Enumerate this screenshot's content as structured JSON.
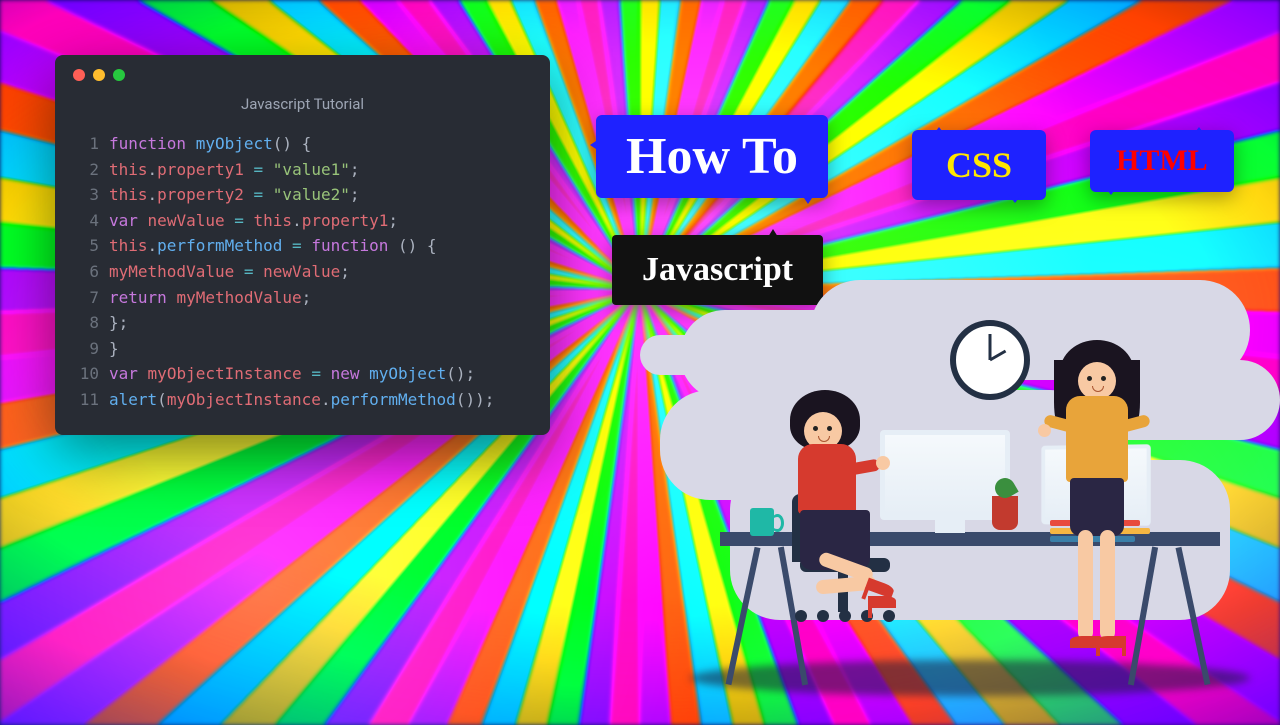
{
  "editor": {
    "title": "Javascript Tutorial",
    "lines": [
      {
        "ln": "1",
        "tokens": [
          {
            "c": "kw",
            "t": "function"
          },
          {
            "c": "plain",
            "t": " "
          },
          {
            "c": "fn",
            "t": "myObject"
          },
          {
            "c": "plain",
            "t": "() {"
          }
        ]
      },
      {
        "ln": "2",
        "tokens": [
          {
            "c": "plain",
            "t": "    "
          },
          {
            "c": "this",
            "t": "this"
          },
          {
            "c": "plain",
            "t": "."
          },
          {
            "c": "prop",
            "t": "property1"
          },
          {
            "c": "plain",
            "t": " "
          },
          {
            "c": "op",
            "t": "="
          },
          {
            "c": "plain",
            "t": " "
          },
          {
            "c": "str",
            "t": "\"value1\""
          },
          {
            "c": "plain",
            "t": ";"
          }
        ]
      },
      {
        "ln": "3",
        "tokens": [
          {
            "c": "plain",
            "t": "    "
          },
          {
            "c": "this",
            "t": "this"
          },
          {
            "c": "plain",
            "t": "."
          },
          {
            "c": "prop",
            "t": "property2"
          },
          {
            "c": "plain",
            "t": " "
          },
          {
            "c": "op",
            "t": "="
          },
          {
            "c": "plain",
            "t": " "
          },
          {
            "c": "str",
            "t": "\"value2\""
          },
          {
            "c": "plain",
            "t": ";"
          }
        ]
      },
      {
        "ln": "4",
        "tokens": [
          {
            "c": "plain",
            "t": "    "
          },
          {
            "c": "kw",
            "t": "var"
          },
          {
            "c": "plain",
            "t": " "
          },
          {
            "c": "var",
            "t": "newValue"
          },
          {
            "c": "plain",
            "t": " "
          },
          {
            "c": "op",
            "t": "="
          },
          {
            "c": "plain",
            "t": " "
          },
          {
            "c": "this",
            "t": "this"
          },
          {
            "c": "plain",
            "t": "."
          },
          {
            "c": "prop",
            "t": "property1"
          },
          {
            "c": "plain",
            "t": ";"
          }
        ]
      },
      {
        "ln": "5",
        "tokens": [
          {
            "c": "plain",
            "t": "    "
          },
          {
            "c": "this",
            "t": "this"
          },
          {
            "c": "plain",
            "t": "."
          },
          {
            "c": "meth",
            "t": "performMethod"
          },
          {
            "c": "plain",
            "t": " "
          },
          {
            "c": "op",
            "t": "="
          },
          {
            "c": "plain",
            "t": " "
          },
          {
            "c": "kw",
            "t": "function"
          },
          {
            "c": "plain",
            "t": " () {"
          }
        ]
      },
      {
        "ln": "6",
        "tokens": [
          {
            "c": "plain",
            "t": "        "
          },
          {
            "c": "var",
            "t": "myMethodValue"
          },
          {
            "c": "plain",
            "t": " "
          },
          {
            "c": "op",
            "t": "="
          },
          {
            "c": "plain",
            "t": " "
          },
          {
            "c": "var",
            "t": "newValue"
          },
          {
            "c": "plain",
            "t": ";"
          }
        ]
      },
      {
        "ln": "7",
        "tokens": [
          {
            "c": "plain",
            "t": "        "
          },
          {
            "c": "kw",
            "t": "return"
          },
          {
            "c": "plain",
            "t": " "
          },
          {
            "c": "var",
            "t": "myMethodValue"
          },
          {
            "c": "plain",
            "t": ";"
          }
        ]
      },
      {
        "ln": "8",
        "tokens": [
          {
            "c": "plain",
            "t": "    };"
          }
        ]
      },
      {
        "ln": "9",
        "tokens": [
          {
            "c": "plain",
            "t": "}"
          }
        ]
      },
      {
        "ln": "10",
        "tokens": [
          {
            "c": "kw",
            "t": "var"
          },
          {
            "c": "plain",
            "t": " "
          },
          {
            "c": "var",
            "t": "myObjectInstance"
          },
          {
            "c": "plain",
            "t": " "
          },
          {
            "c": "op",
            "t": "="
          },
          {
            "c": "plain",
            "t": " "
          },
          {
            "c": "new",
            "t": "new"
          },
          {
            "c": "plain",
            "t": " "
          },
          {
            "c": "fn",
            "t": "myObject"
          },
          {
            "c": "plain",
            "t": "();"
          }
        ]
      },
      {
        "ln": "11",
        "tokens": [
          {
            "c": "call",
            "t": "alert"
          },
          {
            "c": "plain",
            "t": "("
          },
          {
            "c": "var",
            "t": "myObjectInstance"
          },
          {
            "c": "plain",
            "t": "."
          },
          {
            "c": "meth",
            "t": "performMethod"
          },
          {
            "c": "plain",
            "t": "());"
          }
        ]
      }
    ]
  },
  "tags": {
    "howto": "How To",
    "css": "CSS",
    "html": "HTML",
    "js": "Javascript"
  }
}
